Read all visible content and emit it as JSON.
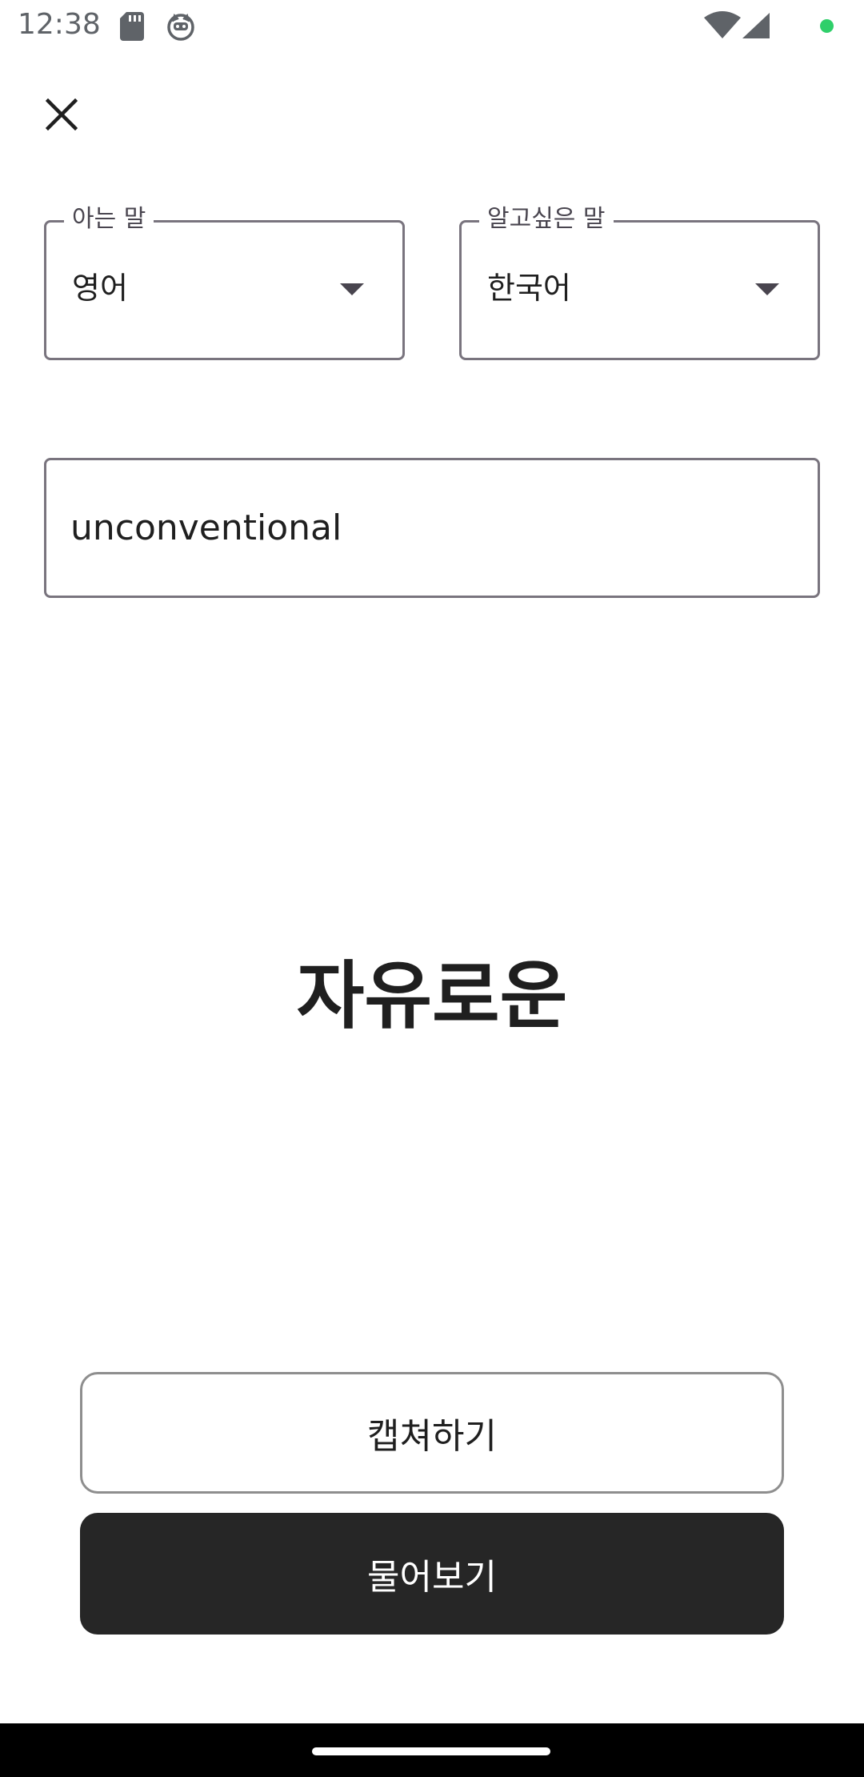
{
  "status_bar": {
    "time": "12:38",
    "icons": [
      "sd-card-icon",
      "cat-icon",
      "wifi-icon",
      "cellular-icon",
      "status-dot-icon"
    ],
    "dot_color": "#2fcf6a"
  },
  "header": {
    "close_icon": "close-icon"
  },
  "language_selectors": {
    "known": {
      "label": "아는 말",
      "value": "영어"
    },
    "learn": {
      "label": "알고싶은 말",
      "value": "한국어"
    }
  },
  "input": {
    "value": "unconventional"
  },
  "result": {
    "text": "자유로운"
  },
  "actions": {
    "capture_label": "캡쳐하기",
    "ask_label": "물어보기",
    "ask_color": "#262626"
  }
}
